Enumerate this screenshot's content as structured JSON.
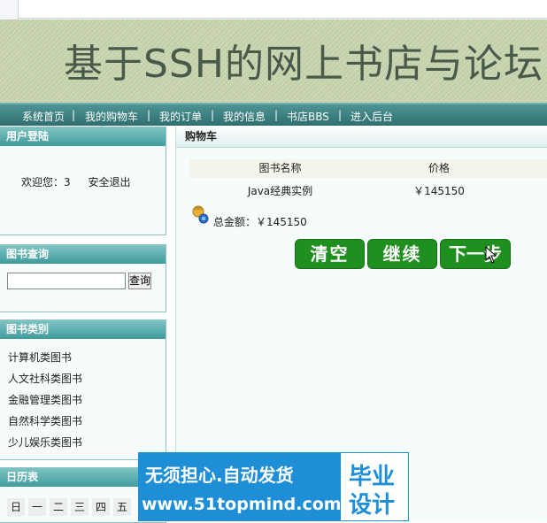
{
  "site": {
    "title": "基于SSH的网上书店与论坛"
  },
  "nav": {
    "items": [
      "系统首页",
      "我的购物车",
      "我的订单",
      "我的信息",
      "书店BBS",
      "进入后台"
    ],
    "separator": "|"
  },
  "sidebar": {
    "login": {
      "title": "用户登陆",
      "welcome": "欢迎您：3",
      "logout": "安全退出"
    },
    "search": {
      "title": "图书查询",
      "input_value": "",
      "button": "查询"
    },
    "categories": {
      "title": "图书类别",
      "items": [
        "计算机类图书",
        "人文社科类图书",
        "金融管理类图书",
        "自然科学类图书",
        "少儿娱乐类图书"
      ]
    },
    "calendar": {
      "title": "日历表",
      "weekdays": [
        "日",
        "一",
        "二",
        "三",
        "四",
        "五"
      ]
    }
  },
  "cart": {
    "title": "购物车",
    "columns": [
      "图书名称",
      "价格"
    ],
    "rows": [
      {
        "name": "Java经典实例",
        "price": "￥145150"
      }
    ],
    "total_label": "总金额：￥145150",
    "buttons": {
      "clear": "清空",
      "continue": "继续",
      "next": "下一步"
    }
  },
  "watermark": {
    "line1": "无须担心.自动发货",
    "line2": "www.51topmind.com",
    "right1": "毕业",
    "right2": "设计"
  },
  "colors": {
    "nav_bg": "#2f6e6f",
    "panel_head": "#3f9c9c",
    "button_green": "#1f8f1f",
    "watermark_blue": "#1e8fd6"
  }
}
